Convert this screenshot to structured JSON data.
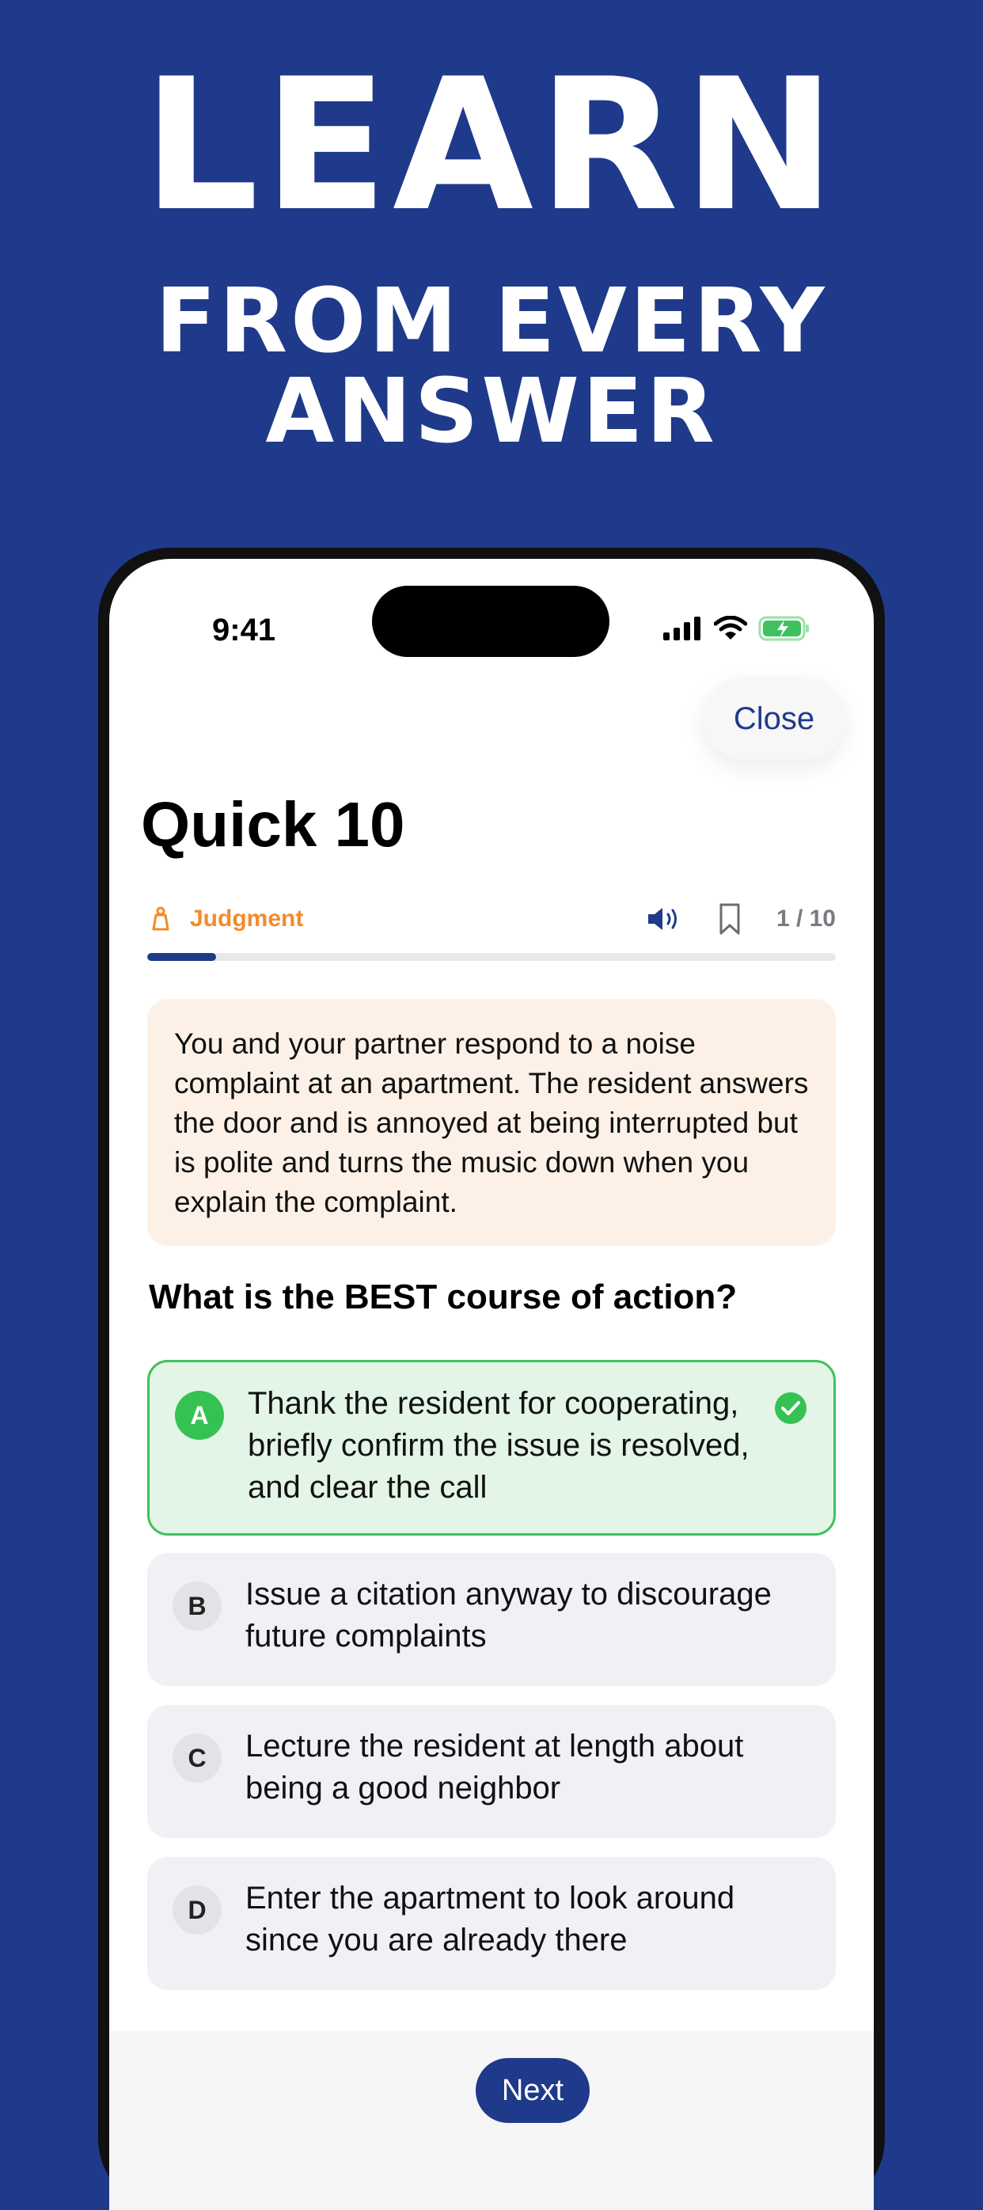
{
  "headline": {
    "line1": "LEARN",
    "line2": "FROM EVERY",
    "line3": "ANSWER"
  },
  "status_bar": {
    "time": "9:41",
    "icons": [
      "cellular-signal-icon",
      "wifi-icon",
      "battery-charging-icon"
    ]
  },
  "header": {
    "close_label": "Close",
    "title": "Quick 10"
  },
  "quiz_meta": {
    "category_icon": "weight-icon",
    "category": "Judgment",
    "counter": "1 / 10",
    "progress": 0.1
  },
  "scenario": "You and your partner respond to a noise complaint at an apartment. The resident answers the door and is annoyed at being interrupted but is polite and turns the music down when you explain the complaint.",
  "question": "What is the BEST course of action?",
  "options": [
    {
      "letter": "A",
      "text": "Thank the resident for cooperating, briefly confirm the issue is resolved, and clear the call",
      "state": "correct"
    },
    {
      "letter": "B",
      "text": "Issue a citation anyway to discourage future complaints",
      "state": "default"
    },
    {
      "letter": "C",
      "text": "Lecture the resident at length about being a good neighbor",
      "state": "default"
    },
    {
      "letter": "D",
      "text": "Enter the apartment to look around since you are already there",
      "state": "default"
    }
  ],
  "footer": {
    "next_label": "Next"
  },
  "colors": {
    "background": "#1f3a8a",
    "accent": "#1f3a8a",
    "category": "#f28c28",
    "correct": "#35c253",
    "scenario_bg": "#fdf1e7"
  }
}
